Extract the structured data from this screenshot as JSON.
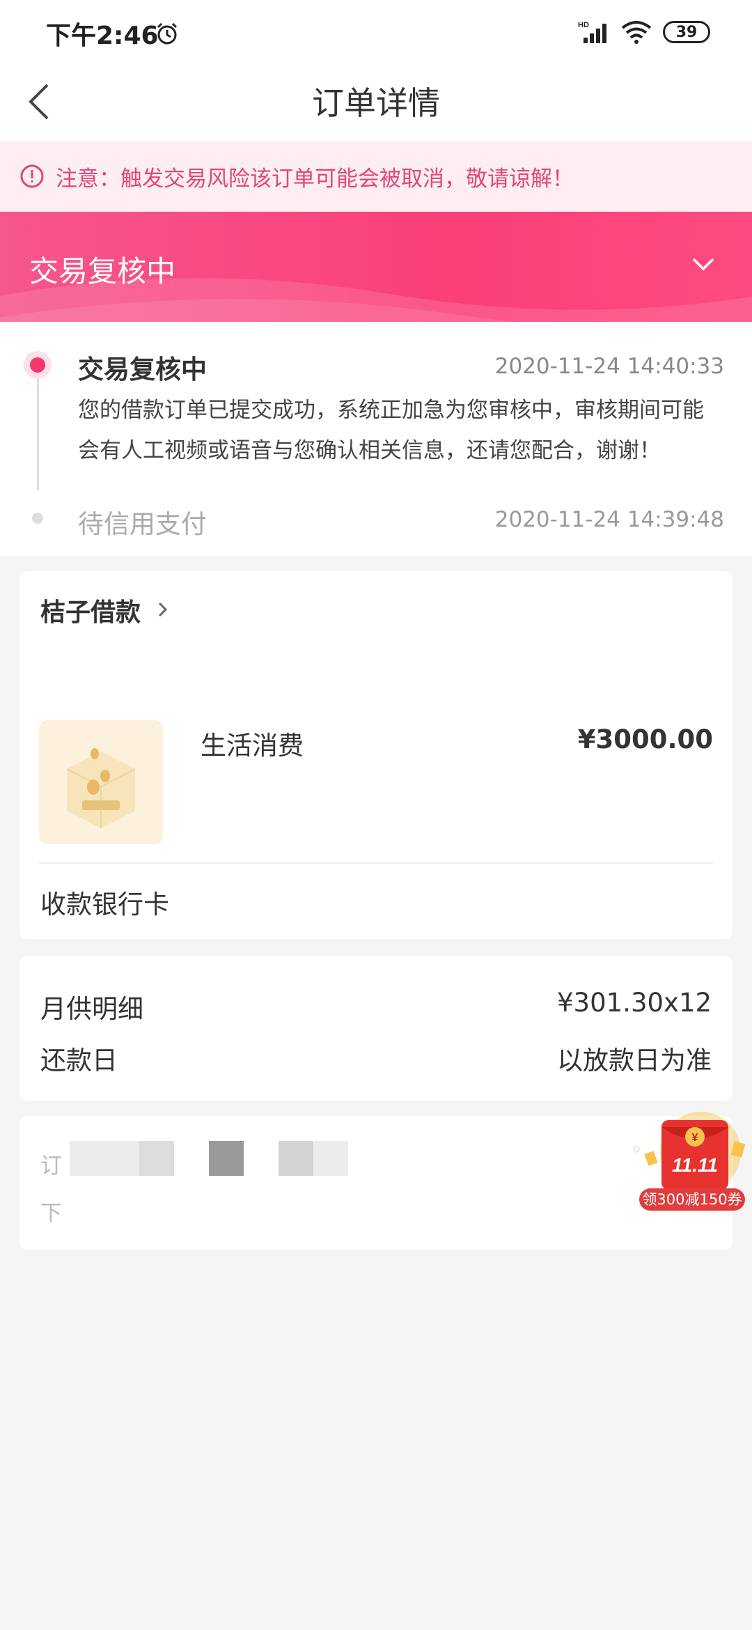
{
  "status_bar": {
    "time": "下午2:46",
    "battery": "39"
  },
  "nav": {
    "title": "订单详情"
  },
  "notice": {
    "text": "注意：触发交易风险该订单可能会被取消，敬请谅解！"
  },
  "status_banner": {
    "title": "交易复核中"
  },
  "timeline": [
    {
      "title": "交易复核中",
      "time": "2020-11-24 14:40:33",
      "description": "您的借款订单已提交成功，系统正加急为您审核中，审核期间可能会有人工视频或语音与您确认相关信息，还请您配合，谢谢！"
    },
    {
      "title": "待信用支付",
      "time": "2020-11-24 14:39:48"
    }
  ],
  "order": {
    "merchant": "桔子借款",
    "product_name": "生活消费",
    "price": "¥3000.00",
    "bank_card_label": "收款银行卡"
  },
  "plan": {
    "monthly_label": "月供明细",
    "monthly_value": "¥301.30x12",
    "repay_day_label": "还款日",
    "repay_day_value": "以放款日为准"
  },
  "order_info": {
    "line1_label": "订",
    "line2_label": "下"
  },
  "promo": {
    "badge": "11.11",
    "label": "领300减150券"
  },
  "colors": {
    "accent": "#f2386c",
    "notice_text": "#e2457a",
    "notice_bg": "#fdeef1"
  }
}
